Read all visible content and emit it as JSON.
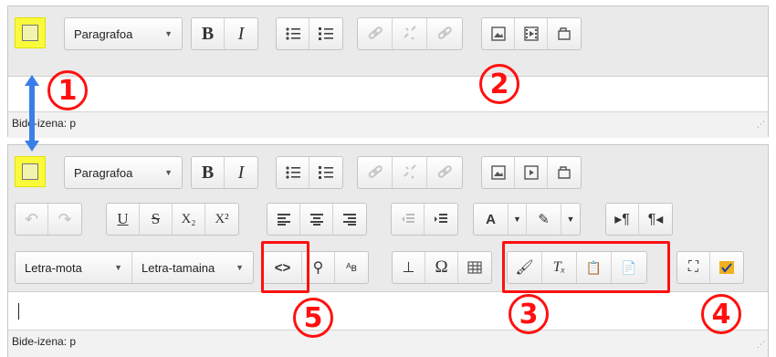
{
  "colors": {
    "toggle_highlight": "#fafa3c",
    "annotation_red": "#ff1010",
    "arrow_blue": "#3a7fe8"
  },
  "editor_top": {
    "format_select": "Paragrafoa",
    "status": "Bide-izena: p"
  },
  "editor_bottom": {
    "format_select": "Paragrafoa",
    "font_family_select": "Letra-mota",
    "font_size_select": "Letra-tamaina",
    "status": "Bide-izena: p"
  },
  "labels": {
    "bold": "B",
    "italic": "I",
    "underline": "U",
    "strike": "S",
    "subscript": "X₂",
    "superscript": "X²",
    "omega": "Ω"
  },
  "callouts": {
    "c1": "1",
    "c2": "2",
    "c3": "3",
    "c4": "4",
    "c5": "5"
  },
  "icons": [
    "toolbar-toggle-icon",
    "bullet-list-icon",
    "numbered-list-icon",
    "link-icon",
    "unlink-icon",
    "anchor-icon",
    "image-icon",
    "media-icon",
    "manage-files-icon",
    "undo-icon",
    "redo-icon",
    "align-left-icon",
    "align-center-icon",
    "align-right-icon",
    "outdent-icon",
    "indent-icon",
    "text-color-icon",
    "background-color-icon",
    "ltr-icon",
    "rtl-icon",
    "html-source-icon",
    "find-replace-icon",
    "case-change-icon",
    "nonbreaking-icon",
    "table-icon",
    "clean-html-icon",
    "clear-formatting-icon",
    "paste-text-icon",
    "paste-word-icon",
    "fullscreen-icon",
    "spellcheck-icon"
  ]
}
